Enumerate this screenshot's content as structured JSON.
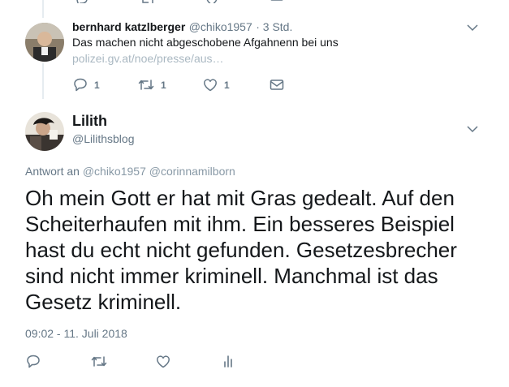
{
  "reply_tweet": {
    "author_name": "bernhard katzlberger",
    "author_handle": "@chiko1957",
    "time": "· 3 Std.",
    "text": "Das machen nicht abgeschobene Afgahnenn bei uns",
    "link": "polizei.gv.at/noe/presse/aus…",
    "actions": {
      "reply_count": "1",
      "retweet_count": "1",
      "like_count": "1"
    }
  },
  "main_tweet": {
    "author_name": "Lilith",
    "author_handle": "@Lilithsblog",
    "reply_prefix": "Antwort an",
    "reply_mentions": [
      "@chiko1957",
      "@corinnamilborn"
    ],
    "text": "Oh mein Gott er hat mit Gras gedealt. Auf den Scheiterhaufen mit ihm. Ein besseres Beispiel hast du echt nicht gefunden. Gesetzesbrecher sind nicht immer kriminell. Manchmal ist das Gesetz kriminell.",
    "timestamp": "09:02 - 11. Juli 2018"
  },
  "icons": {
    "reply": "reply-icon",
    "retweet": "retweet-icon",
    "like": "heart-icon",
    "dm": "mail-icon",
    "analytics": "analytics-icon",
    "more": "chevron-down-icon"
  },
  "colors": {
    "text": "#14171a",
    "secondary": "#657786",
    "muted_link": "#aab8c2",
    "thread_line": "#e6ecf0"
  }
}
